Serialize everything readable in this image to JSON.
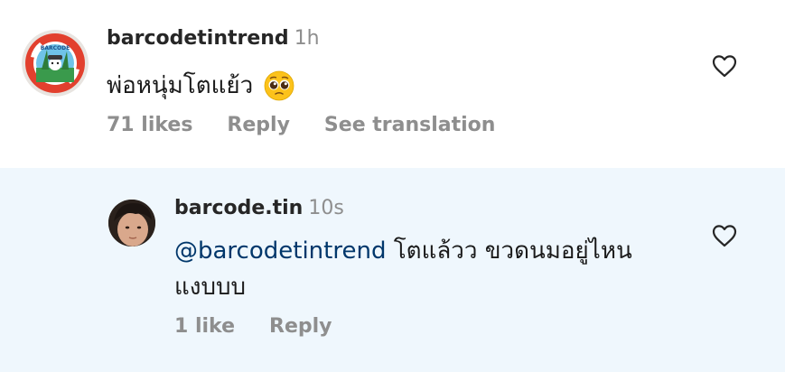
{
  "comment": {
    "username": "barcodetintrend",
    "time": "1h",
    "text": "พ่อหนุ่มโตแย้ว",
    "emoji": "pleading-face-emoji",
    "likes": "71 likes",
    "reply_label": "Reply",
    "translation_label": "See translation",
    "like_icon": "heart-outline-icon"
  },
  "reply": {
    "username": "barcode.tin",
    "time": "10s",
    "mention": "@barcodetintrend",
    "text": " โตแล้วว ขวดนมอยู่ไหนแงบบบ",
    "likes": "1 like",
    "reply_label": "Reply",
    "like_icon": "heart-outline-icon"
  },
  "colors": {
    "reply_background": "#eff7fd",
    "mention": "#00376b",
    "secondary_text": "#8e8e8e"
  }
}
